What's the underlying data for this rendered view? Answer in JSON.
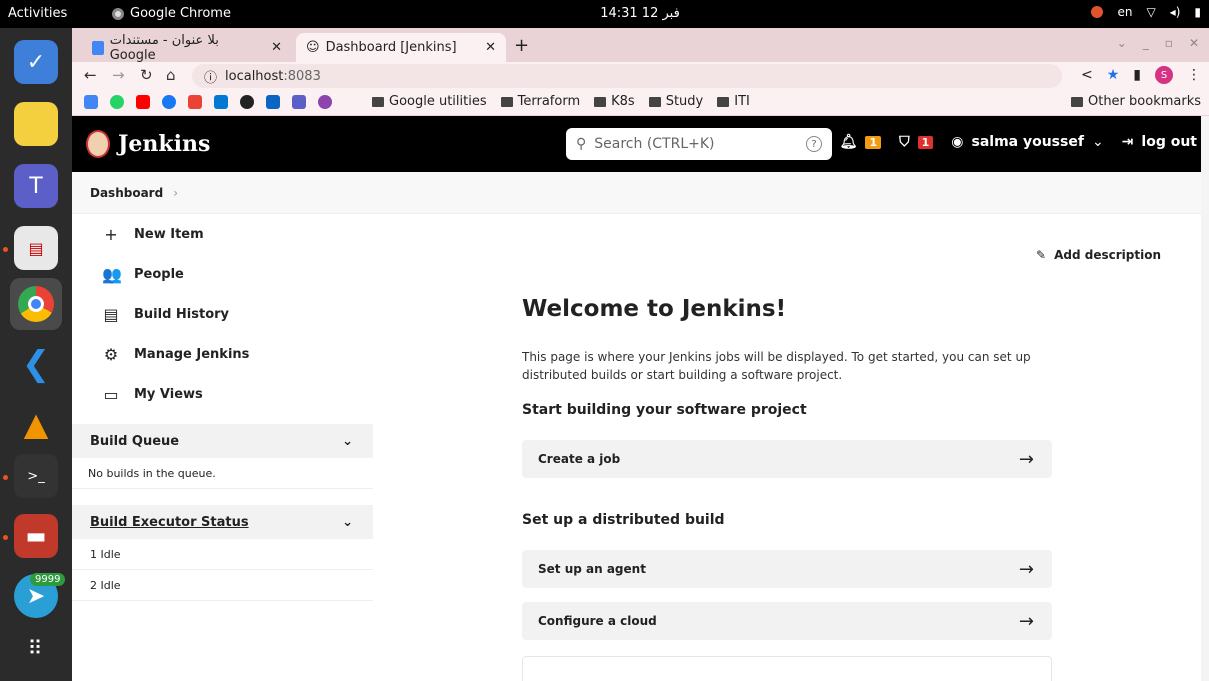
{
  "os": {
    "activities": "Activities",
    "app_name": "Google Chrome",
    "clock": "14:31 12 فبر",
    "lang": "en",
    "dock_badge": "9999"
  },
  "browser": {
    "tabs": [
      {
        "label": "بلا عنوان - مستندات Google"
      },
      {
        "label": "Dashboard [Jenkins]"
      }
    ],
    "url_host": "localhost",
    "url_port": ":8083",
    "bookmark_folders": [
      "Google utilities",
      "Terraform",
      "K8s",
      "Study",
      "ITI"
    ],
    "other_bookmarks": "Other bookmarks",
    "profile_letter": "S"
  },
  "jenkins": {
    "title": "Jenkins",
    "search_placeholder": "Search (CTRL+K)",
    "notifications_count": "1",
    "security_count": "1",
    "user": "salma youssef",
    "logout": "log out",
    "breadcrumb": "Dashboard",
    "tasks": [
      {
        "icon": "+",
        "label": "New Item"
      },
      {
        "icon": "👥",
        "label": "People"
      },
      {
        "icon": "▤",
        "label": "Build History"
      },
      {
        "icon": "⚙",
        "label": "Manage Jenkins"
      },
      {
        "icon": "▭",
        "label": "My Views"
      }
    ],
    "build_queue": {
      "title": "Build Queue",
      "empty": "No builds in the queue."
    },
    "executors": {
      "title": "Build Executor Status",
      "rows": [
        "1  Idle",
        "2  Idle"
      ]
    },
    "add_description": "Add description",
    "welcome": "Welcome to Jenkins!",
    "intro": "This page is where your Jenkins jobs will be displayed. To get started, you can set up distributed builds or start building a software project.",
    "section_software": "Start building your software project",
    "create_job": "Create a job",
    "section_distributed": "Set up a distributed build",
    "setup_agent": "Set up an agent",
    "configure_cloud": "Configure a cloud"
  }
}
